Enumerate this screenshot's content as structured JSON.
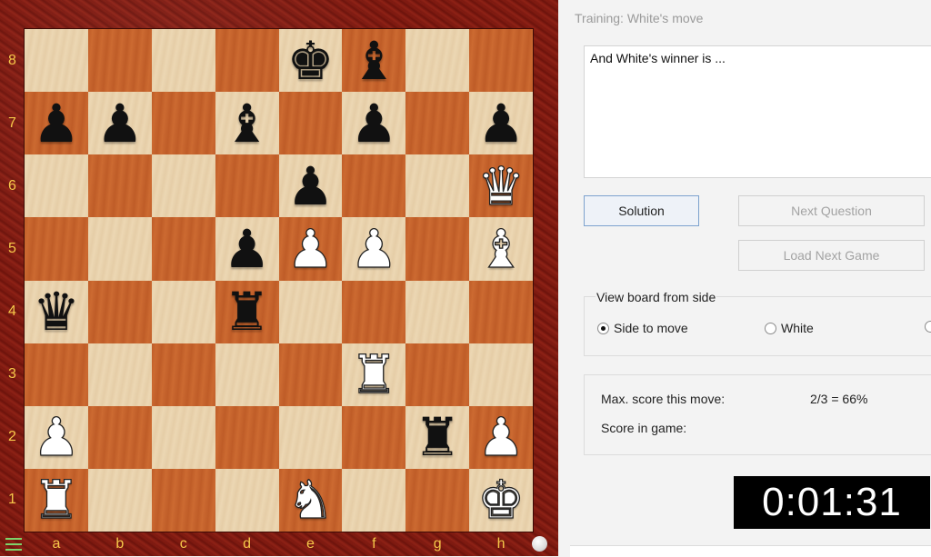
{
  "board": {
    "ranks": [
      "8",
      "7",
      "6",
      "5",
      "4",
      "3",
      "2",
      "1"
    ],
    "files": [
      "a",
      "b",
      "c",
      "d",
      "e",
      "f",
      "g",
      "h"
    ],
    "pieces": [
      {
        "square": "e8",
        "color": "b",
        "type": "K",
        "glyph": "♚",
        "name": "black-king"
      },
      {
        "square": "f8",
        "color": "b",
        "type": "B",
        "glyph": "♝",
        "name": "black-bishop"
      },
      {
        "square": "a7",
        "color": "b",
        "type": "P",
        "glyph": "♟",
        "name": "black-pawn"
      },
      {
        "square": "b7",
        "color": "b",
        "type": "P",
        "glyph": "♟",
        "name": "black-pawn"
      },
      {
        "square": "d7",
        "color": "b",
        "type": "B",
        "glyph": "♝",
        "name": "black-bishop"
      },
      {
        "square": "f7",
        "color": "b",
        "type": "P",
        "glyph": "♟",
        "name": "black-pawn"
      },
      {
        "square": "h7",
        "color": "b",
        "type": "P",
        "glyph": "♟",
        "name": "black-pawn"
      },
      {
        "square": "e6",
        "color": "b",
        "type": "P",
        "glyph": "♟",
        "name": "black-pawn"
      },
      {
        "square": "h6",
        "color": "w",
        "type": "Q",
        "glyph": "♛",
        "name": "white-queen"
      },
      {
        "square": "d5",
        "color": "b",
        "type": "P",
        "glyph": "♟",
        "name": "black-pawn"
      },
      {
        "square": "e5",
        "color": "w",
        "type": "P",
        "glyph": "♟",
        "name": "white-pawn"
      },
      {
        "square": "f5",
        "color": "w",
        "type": "P",
        "glyph": "♟",
        "name": "white-pawn"
      },
      {
        "square": "h5",
        "color": "w",
        "type": "B",
        "glyph": "♝",
        "name": "white-bishop"
      },
      {
        "square": "a4",
        "color": "b",
        "type": "Q",
        "glyph": "♛",
        "name": "black-queen"
      },
      {
        "square": "d4",
        "color": "b",
        "type": "R",
        "glyph": "♜",
        "name": "black-rook"
      },
      {
        "square": "f3",
        "color": "w",
        "type": "R",
        "glyph": "♜",
        "name": "white-rook"
      },
      {
        "square": "a2",
        "color": "w",
        "type": "P",
        "glyph": "♟",
        "name": "white-pawn"
      },
      {
        "square": "g2",
        "color": "b",
        "type": "R",
        "glyph": "♜",
        "name": "black-rook"
      },
      {
        "square": "h2",
        "color": "w",
        "type": "P",
        "glyph": "♟",
        "name": "white-pawn"
      },
      {
        "square": "a1",
        "color": "w",
        "type": "R",
        "glyph": "♜",
        "name": "white-rook"
      },
      {
        "square": "e1",
        "color": "w",
        "type": "N",
        "glyph": "♞",
        "name": "white-knight"
      },
      {
        "square": "h1",
        "color": "w",
        "type": "K",
        "glyph": "♚",
        "name": "white-king"
      }
    ],
    "icons": {
      "menu": "hamburger-icon",
      "turn": "white-to-move-indicator"
    }
  },
  "panel": {
    "title": "Training: White's move",
    "question": "And White's winner is ...",
    "buttons": {
      "solution": "Solution",
      "next_question": "Next Question",
      "load_next_game": "Load Next Game"
    },
    "view_board": {
      "label": "View board from side",
      "options": [
        {
          "label": "Side to move",
          "selected": true
        },
        {
          "label": "White",
          "selected": false
        }
      ]
    },
    "score": {
      "max_label": "Max. score this move:",
      "max_value": "2/3 =  66%",
      "game_label": "Score in game:",
      "game_value": ""
    },
    "timer": "0:01:31"
  },
  "colors": {
    "frame": "#7a1810",
    "light_square": "#ecd7b3",
    "dark_square": "#cc6a31",
    "coordinates": "#f6c84a",
    "timer_bg": "#000000"
  }
}
